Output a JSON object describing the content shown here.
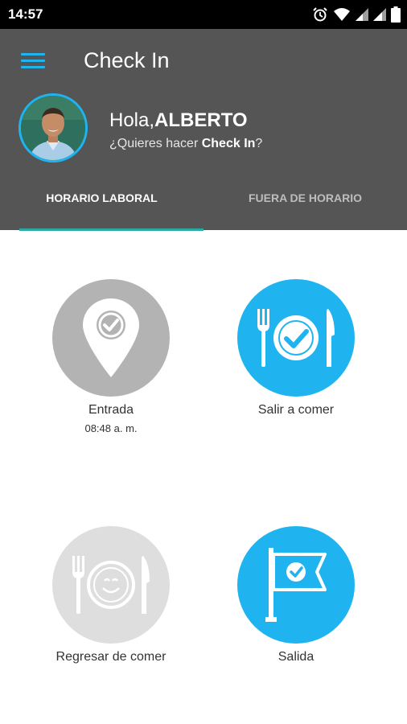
{
  "status_bar": {
    "time": "14:57"
  },
  "app": {
    "title": "Check In"
  },
  "user": {
    "greeting": "Hola,",
    "name": "ALBERTO",
    "question_prefix": "¿Quieres hacer ",
    "question_bold": "Check In",
    "question_suffix": "?"
  },
  "tabs": [
    {
      "label": "HORARIO LABORAL",
      "active": true
    },
    {
      "label": "FUERA DE HORARIO",
      "active": false
    }
  ],
  "actions": {
    "entrada": {
      "label": "Entrada",
      "time": "08:48 a. m.",
      "state": "done",
      "icon": "location-check-icon"
    },
    "salir_comer": {
      "label": "Salir a comer",
      "state": "enabled",
      "icon": "meal-check-icon"
    },
    "regresar_comer": {
      "label": "Regresar de comer",
      "state": "disabled",
      "icon": "meal-smile-icon"
    },
    "salida": {
      "label": "Salida",
      "state": "enabled",
      "icon": "flag-check-icon"
    }
  },
  "colors": {
    "accent": "#1FB4EF",
    "header": "#555555",
    "tab_indicator": "#2AA9A5",
    "done_gray": "#B3B3B3",
    "disabled_gray": "#DEDEDE"
  }
}
